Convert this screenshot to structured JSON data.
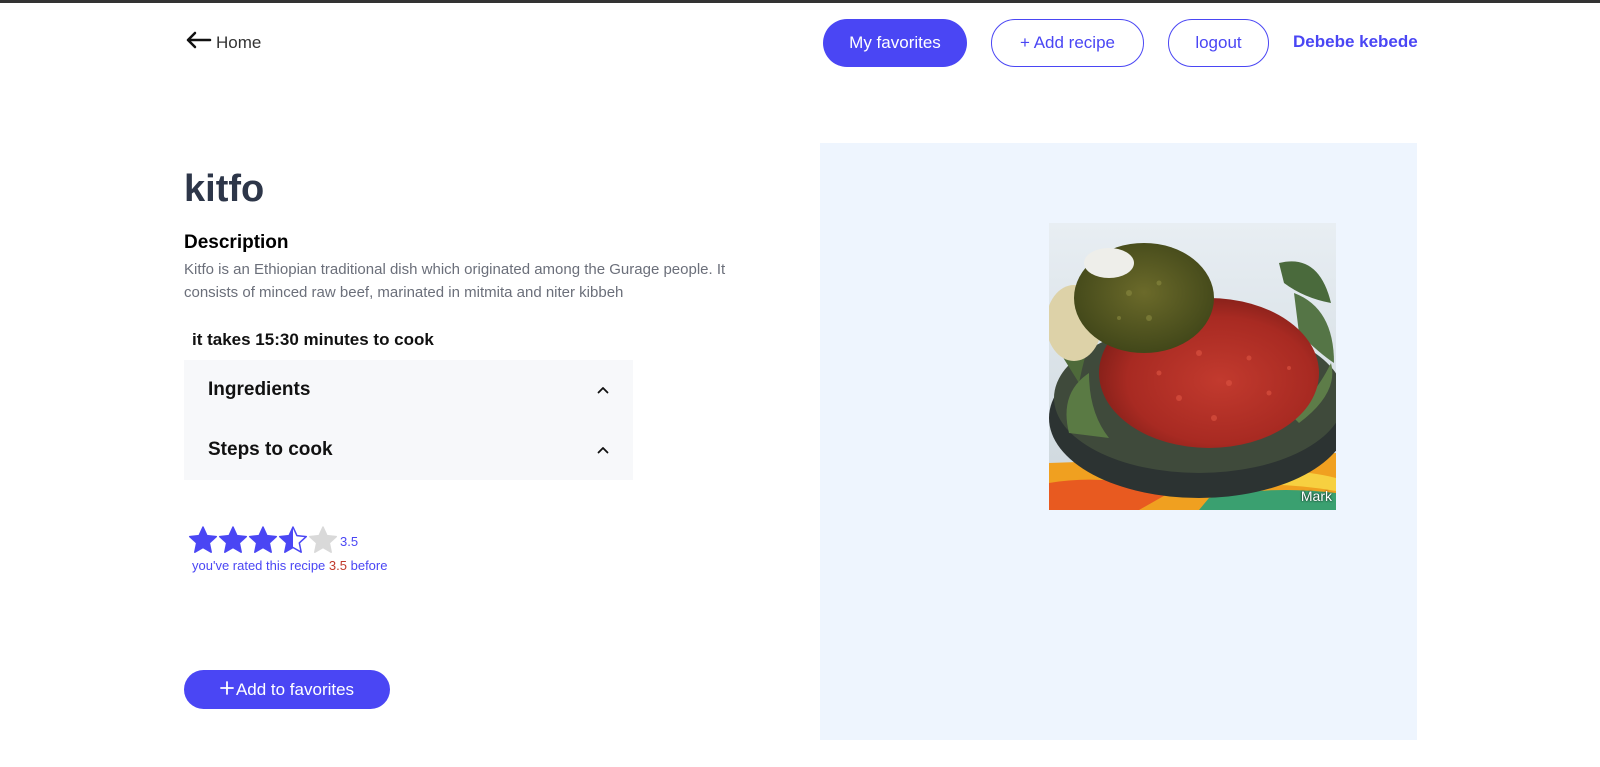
{
  "header": {
    "home_label": "Home",
    "my_favorites_label": "My favorites",
    "add_recipe_label": "+ Add recipe",
    "logout_label": "logout",
    "user_name": "Debebe kebede"
  },
  "recipe": {
    "title": "kitfo",
    "description_heading": "Description",
    "description": "Kitfo is an Ethiopian traditional dish which originated among the Gurage people. It consists of minced raw beef, marinated in mitmita and niter kibbeh",
    "cook_time_text": "it takes 15:30 minutes to cook",
    "sections": [
      {
        "label": "Ingredients"
      },
      {
        "label": "Steps to cook"
      }
    ],
    "rating": {
      "value": 3.5,
      "max": 5,
      "display": "3.5",
      "note_prefix": "you've rated this recipe",
      "note_value": "3.5",
      "note_suffix": "before"
    },
    "add_to_favorites_label": "Add to favorites",
    "image_watermark": "Mark"
  },
  "colors": {
    "accent": "#4a46f4",
    "panel_bg": "#eef5fe",
    "accordion_bg": "#f7f8fa",
    "star_empty": "#d9d9d9",
    "rated_number": "#c0392b"
  },
  "icons": {
    "home": "arrow-left-icon",
    "accordion": "chevron-up-icon",
    "add": "plus-icon",
    "rating": "star-icon"
  }
}
